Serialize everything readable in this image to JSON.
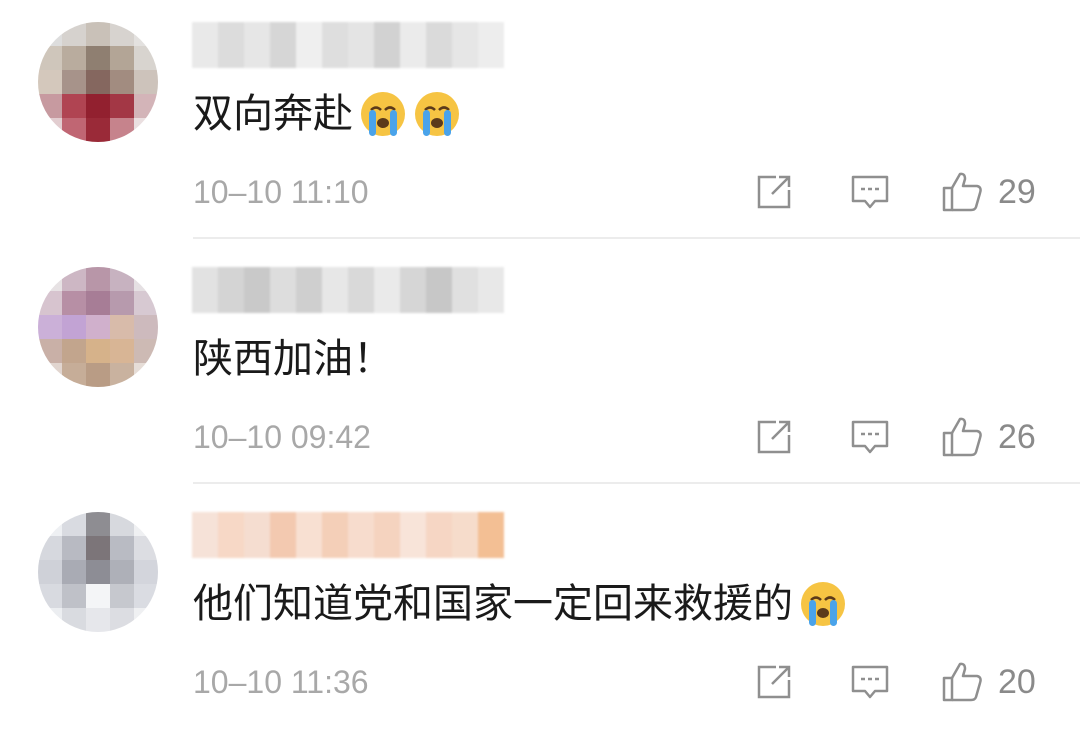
{
  "comments": [
    {
      "text": "双向奔赴",
      "emoji": [
        "crying-face-emoji",
        "crying-face-emoji"
      ],
      "time": "10–10 11:10",
      "likes": "29"
    },
    {
      "text": "陕西加油！",
      "emoji": [],
      "time": "10–10 09:42",
      "likes": "26"
    },
    {
      "text": "他们知道党和国家一定回来救援的",
      "emoji": [
        "crying-face-emoji"
      ],
      "time": "10–10 11:36",
      "likes": "20"
    }
  ],
  "icons": {
    "share": "share-icon",
    "reply": "comment-icon",
    "like": "thumbs-up-icon"
  },
  "colors": {
    "text": "#1a1a1a",
    "meta": "#a8a8a8",
    "icon": "#8f8f8f",
    "divider": "#ececec",
    "emoji_yellow": "#f6c443",
    "emoji_tear": "#4aa3ea"
  }
}
